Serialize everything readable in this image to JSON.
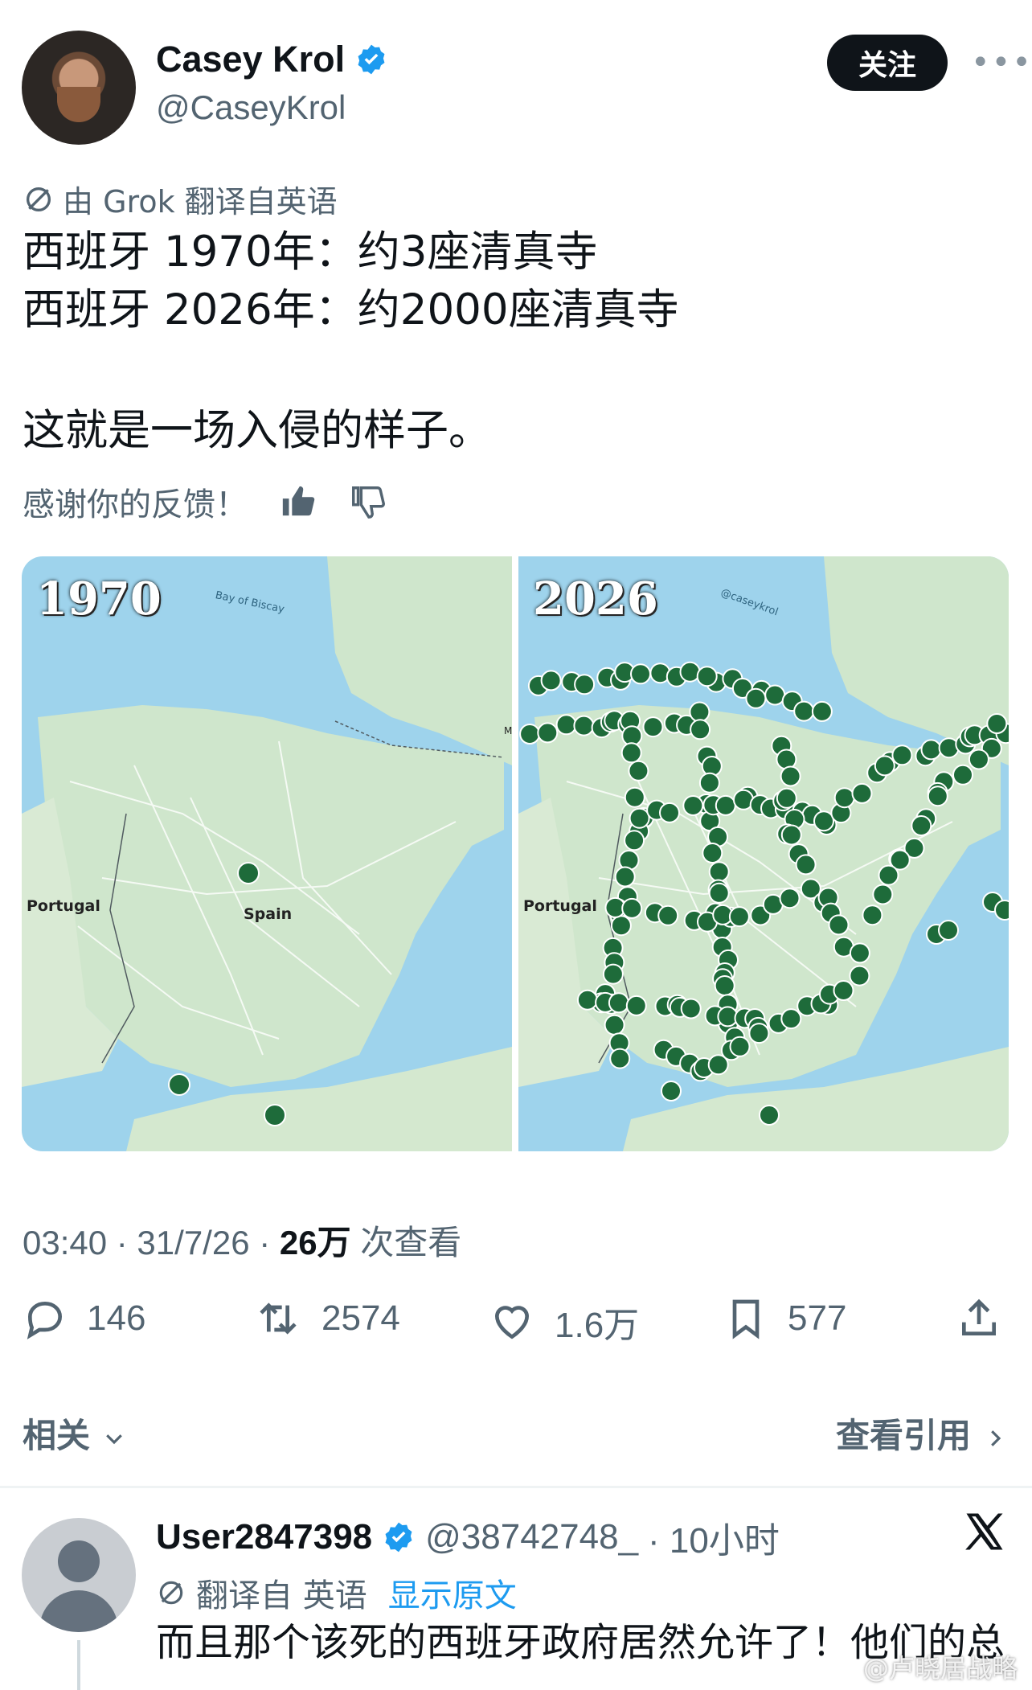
{
  "author": {
    "name": "Casey Krol",
    "handle": "@CaseyKrol",
    "follow_label": "关注",
    "more_label": "•••"
  },
  "translation_note": "由 Grok 翻译自英语",
  "tweet": {
    "line1": "西班牙 1970年：约3座清真寺",
    "line2": "西班牙 2026年：约2000座清真寺",
    "line3": "这就是一场入侵的样子。"
  },
  "feedback_prompt": "感谢你的反馈！",
  "media": {
    "left_year": "1970",
    "right_year": "2026",
    "left_sea_label": "Bay of Biscay",
    "right_watermark": "@caseykrol",
    "portugal_label": "Portugal",
    "spain_label": "Spain",
    "right_portugal_label": "Portugal",
    "edge_letter": "M",
    "colors": {
      "sea": "#9ed3ec",
      "land": "#cfe6cc",
      "marker": "#1e6b3a"
    }
  },
  "meta": {
    "time": "03:40 · 31/7/26 · ",
    "views_count": "26万",
    "views_label": " 次查看"
  },
  "actions": {
    "replies": "146",
    "reposts": "2574",
    "likes": "1.6万",
    "bookmarks": "577"
  },
  "footer": {
    "related_label": "相关",
    "quotes_label": "查看引用"
  },
  "reply": {
    "name": "User2847398",
    "handle": "@38742748_",
    "time": "· 10小时",
    "translation_note": "翻译自 英语",
    "show_original": "显示原文",
    "text": "而且那个该死的西班牙政府居然允许了！他们的总"
  },
  "watermark": "@卢晓居战略"
}
